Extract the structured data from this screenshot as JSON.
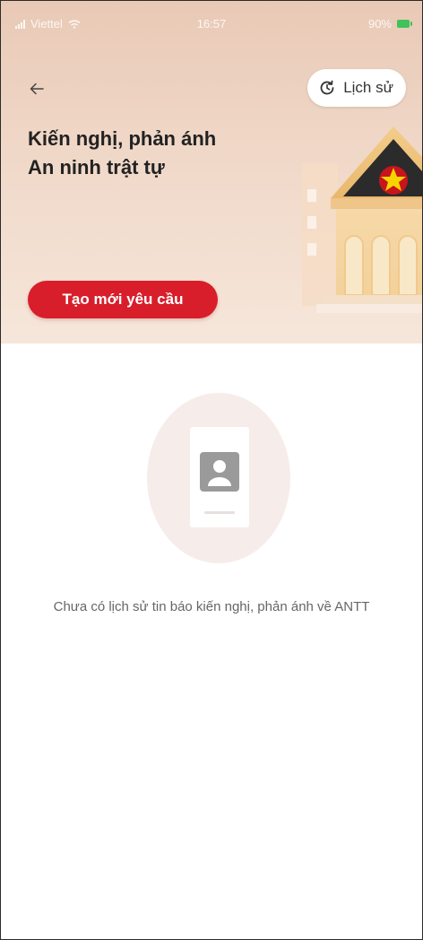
{
  "status_bar": {
    "carrier": "Viettel",
    "time": "16:57",
    "battery": "90%"
  },
  "header": {
    "history_button_label": "Lịch sử",
    "title_line1": "Kiến nghị, phản ánh",
    "title_line2": "An ninh trật tự",
    "create_button_label": "Tạo mới yêu cầu"
  },
  "empty_state": {
    "message": "Chưa có lịch sử tin báo kiến nghị, phản ánh về ANTT"
  },
  "colors": {
    "primary_red": "#d81e2a",
    "hero_bg": "#f0d8c8",
    "battery_green": "#27c04a"
  },
  "icons": [
    "back-arrow-icon",
    "history-clock-icon",
    "police-building-illustration",
    "empty-document-illustration"
  ]
}
